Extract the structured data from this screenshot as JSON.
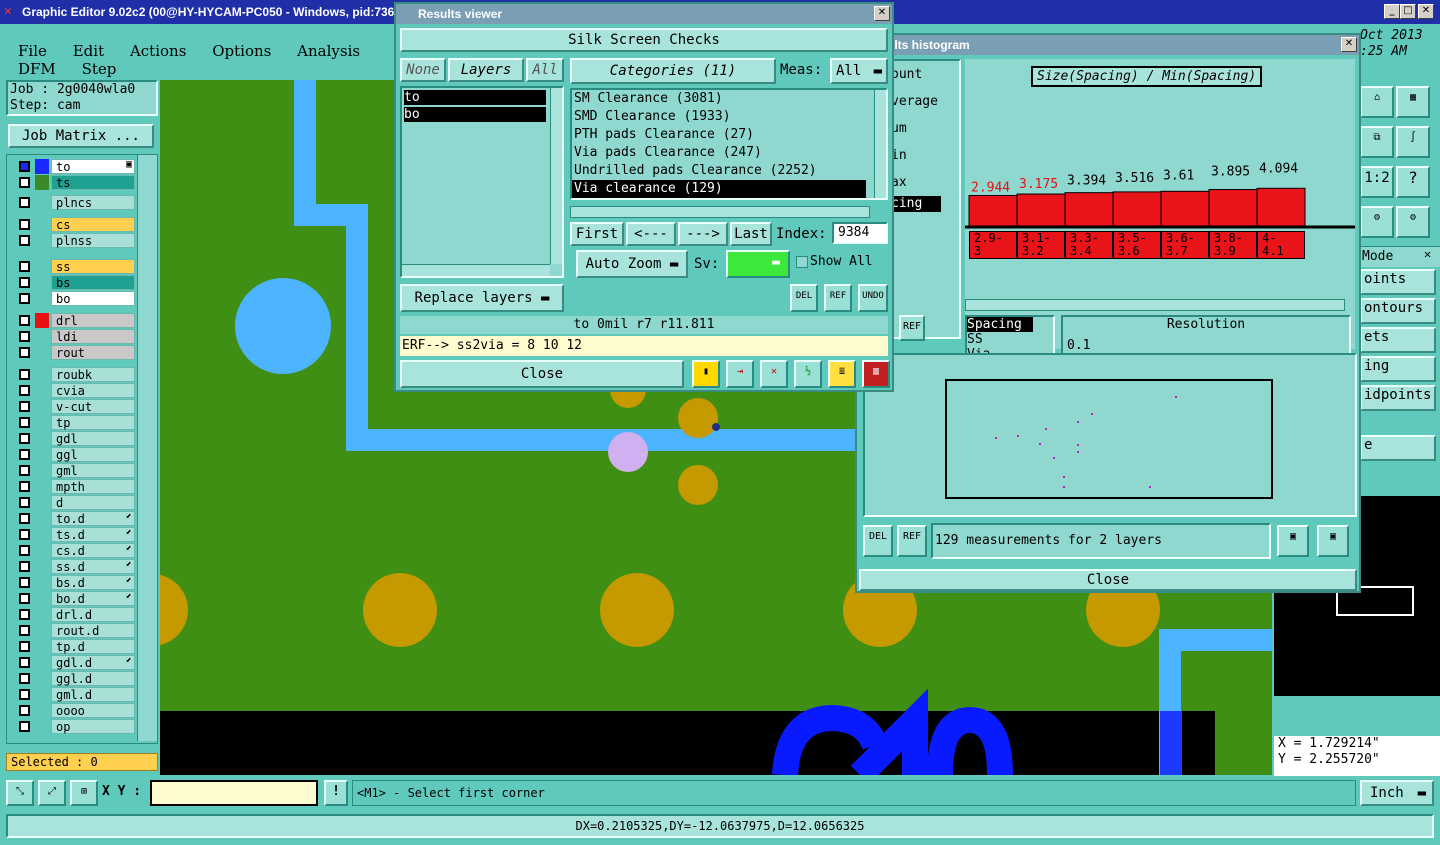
{
  "app": {
    "title": "Graphic Editor 9.02c2 (00@HY-HYCAM-PC050 - Windows, pid:736)"
  },
  "menu": [
    "File",
    "Edit",
    "Actions",
    "Options",
    "Analysis",
    "DFM",
    "Step"
  ],
  "job": {
    "job_label": "Job : 2g0040wla0",
    "step_label": "Step: cam",
    "matrix_button": "Job Matrix ..."
  },
  "layers": [
    {
      "name": "to",
      "color": "#1a2aff",
      "mark": "▣"
    },
    {
      "name": "ts",
      "color": "#3a8a2a",
      "mark": ""
    },
    {
      "name": "plncs",
      "color": "",
      "mark": ""
    },
    {
      "name": "cs",
      "color": "",
      "mark": ""
    },
    {
      "name": "plnss",
      "color": "",
      "mark": ""
    },
    {
      "name": "ss",
      "color": "",
      "mark": ""
    },
    {
      "name": "bs",
      "color": "",
      "mark": ""
    },
    {
      "name": "bo",
      "color": "",
      "mark": ""
    },
    {
      "name": "drl",
      "color": "#e81010",
      "mark": ""
    },
    {
      "name": "ldi",
      "color": "",
      "mark": ""
    },
    {
      "name": "rout",
      "color": "",
      "mark": ""
    },
    {
      "name": "roubk",
      "color": "",
      "mark": ""
    },
    {
      "name": "cvia",
      "color": "",
      "mark": ""
    },
    {
      "name": "v-cut",
      "color": "",
      "mark": ""
    },
    {
      "name": "tp",
      "color": "",
      "mark": ""
    },
    {
      "name": "gdl",
      "color": "",
      "mark": ""
    },
    {
      "name": "ggl",
      "color": "",
      "mark": ""
    },
    {
      "name": "gml",
      "color": "",
      "mark": ""
    },
    {
      "name": "mpth",
      "color": "",
      "mark": ""
    },
    {
      "name": "d",
      "color": "",
      "mark": ""
    },
    {
      "name": "to.d",
      "color": "",
      "mark": "⬋"
    },
    {
      "name": "ts.d",
      "color": "",
      "mark": "⬋"
    },
    {
      "name": "cs.d",
      "color": "",
      "mark": "⬋"
    },
    {
      "name": "ss.d",
      "color": "",
      "mark": "⬋"
    },
    {
      "name": "bs.d",
      "color": "",
      "mark": "⬋"
    },
    {
      "name": "bo.d",
      "color": "",
      "mark": "⬋"
    },
    {
      "name": "drl.d",
      "color": "",
      "mark": ""
    },
    {
      "name": "rout.d",
      "color": "",
      "mark": ""
    },
    {
      "name": "tp.d",
      "color": "",
      "mark": ""
    },
    {
      "name": "gdl.d",
      "color": "",
      "mark": "⬋"
    },
    {
      "name": "ggl.d",
      "color": "",
      "mark": ""
    },
    {
      "name": "gml.d",
      "color": "",
      "mark": ""
    },
    {
      "name": "oooo",
      "color": "",
      "mark": ""
    },
    {
      "name": "op",
      "color": "",
      "mark": ""
    }
  ],
  "selected": "Selected : 0",
  "results_viewer": {
    "title": "Results viewer",
    "header": "Silk Screen Checks",
    "none_btn": "None",
    "layers_btn": "Layers",
    "all_btn": "All",
    "layer_list": [
      "to",
      "bo"
    ],
    "categories_btn": "Categories (11)",
    "meas_label": "Meas:",
    "meas_value": "All",
    "categories": [
      "SM Clearance (3081)",
      "SMD Clearance (1933)",
      "PTH pads Clearance (27)",
      "Via pads Clearance (247)",
      "Undrilled pads Clearance (2252)",
      "Via clearance (129)"
    ],
    "first": "First",
    "prev": "<---",
    "next": "--->",
    "last": "Last",
    "index_label": "Index:",
    "index_value": "9384",
    "auto_zoom": "Auto Zoom",
    "sv_label": "Sv:",
    "show_all": "Show All",
    "replace_layers": "Replace layers",
    "del": "DEL",
    "ref": "REF",
    "undo": "UNDO",
    "info": "to 0mil  r7  r11.811",
    "erf": "ERF--> ss2via = 8 10 12",
    "close": "Close"
  },
  "histogram": {
    "title": "ults histogram",
    "metric_label": "Size(Spacing) / Min(Spacing)",
    "side_labels": [
      "ount",
      "verage",
      "um",
      "in",
      "ax",
      "cing"
    ],
    "ranges": [
      "2.9-\n3",
      "3.1-\n3.2",
      "3.3-\n3.4",
      "3.5-\n3.6",
      "3.6-\n3.7",
      "3.8-\n3.9",
      "4-\n4.1"
    ],
    "list": [
      "Spacing",
      "SS",
      "Via"
    ],
    "resolution_label": "Resolution",
    "resolution_value": "0.1",
    "ref": "REF",
    "del": "DEL",
    "measurements": "129 measurements for 2 layers",
    "close": "Close"
  },
  "chart_data": {
    "type": "bar",
    "categories": [
      "2.9-3",
      "3.1-3.2",
      "3.3-3.4",
      "3.5-3.6",
      "3.6-3.7",
      "3.8-3.9",
      "4-4.1"
    ],
    "values": [
      2.944,
      3.175,
      3.394,
      3.516,
      3.61,
      3.895,
      4.094
    ],
    "title": "Size(Spacing) / Min(Spacing)"
  },
  "right_panel": {
    "date_line1": "Oct 2013",
    "date_line2": ":25 AM",
    "items": [
      "Mode",
      "oints",
      "ontours",
      "ets",
      "ing",
      "idpoints",
      "e"
    ],
    "x_coord": "X = 1.729214\"",
    "y_coord": "Y = 2.255720\""
  },
  "bottom": {
    "xy_label": "X Y :",
    "xy_value": "",
    "status": "<M1> - Select first corner",
    "unit": "Inch",
    "measure": "DX=0.2105325,DY=-12.0637975,D=12.0656325"
  },
  "colors": {
    "board": "#3f8f14",
    "copper": "#c49a00",
    "trace": "#4db4ff",
    "bg": "#5fc9bc"
  }
}
